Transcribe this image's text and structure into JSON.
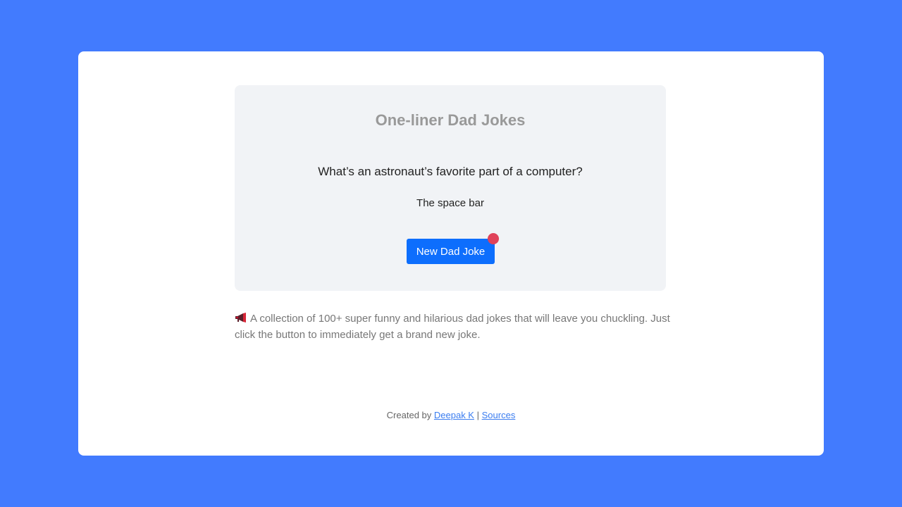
{
  "joke_card": {
    "title": "One-liner Dad Jokes",
    "question": "What’s an astronaut’s favorite part of a computer?",
    "answer": "The space bar",
    "button_label": "New Dad Joke"
  },
  "description": {
    "icon": "megaphone-icon",
    "text": "A collection of 100+ super funny and hilarious dad jokes that will leave you chuckling. Just click the button to immediately get a brand new joke."
  },
  "footer": {
    "prefix": "Created by",
    "author_link": "Deepak K",
    "separator": "|",
    "sources_link": "Sources"
  },
  "colors": {
    "background": "#427bfe",
    "button": "#0d6efd",
    "notification_dot": "#e0425a",
    "link": "#3b7df0"
  }
}
